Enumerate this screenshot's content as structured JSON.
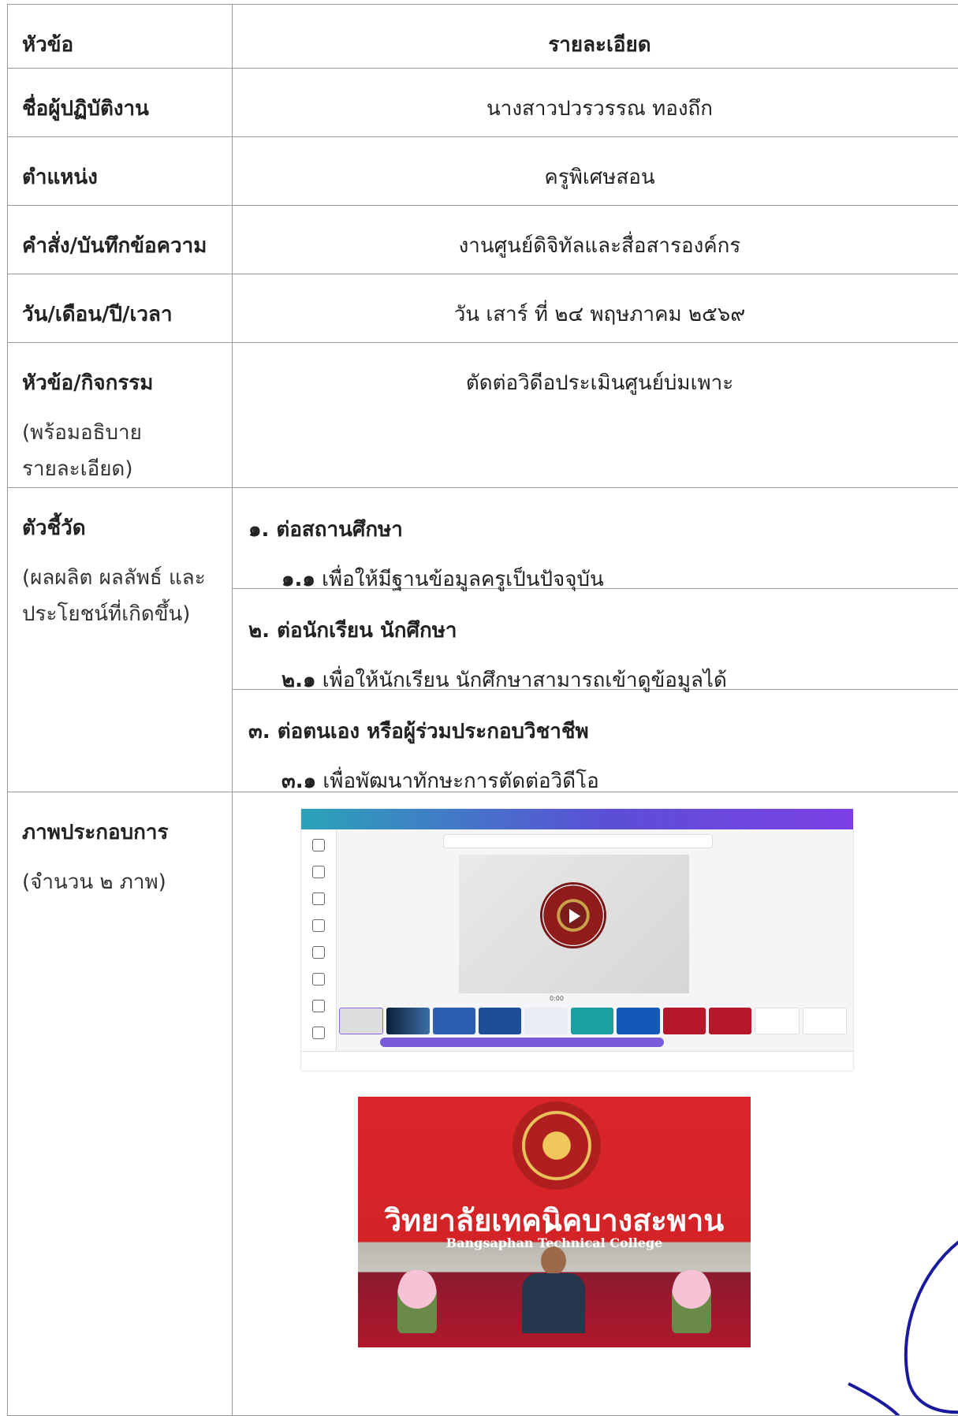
{
  "header": {
    "topic_label": "หัวข้อ",
    "detail_label": "รายละเอียด"
  },
  "rows": {
    "name": {
      "label": "ชื่อผู้ปฏิบัติงาน",
      "value": "นางสาวปวรวรรณ ทองถึก"
    },
    "position": {
      "label": "ตำแหน่ง",
      "value": "ครูพิเศษสอน"
    },
    "order": {
      "label": "คำสั่ง/บันทึกข้อความ",
      "value": "งานศูนย์ดิจิทัลและสื่อสารองค์กร"
    },
    "date": {
      "label": "วัน/เดือน/ปี/เวลา",
      "value": "วัน เสาร์ ที่ ๒๔ พฤษภาคม ๒๕๖๙"
    },
    "activity": {
      "label": "หัวข้อ/กิจกรรม",
      "sub1": "(พร้อมอธิบาย",
      "sub2": "รายละเอียด)",
      "value": "ตัดต่อวิดีอประเมินศูนย์บ่มเพาะ"
    }
  },
  "indicators": {
    "label": "ตัวชี้วัด",
    "sub1": "(ผลผลิต ผลลัพธ์ และ",
    "sub2": "ประโยชน์ที่เกิดขึ้น)",
    "items": [
      {
        "title": "๑. ต่อสถานศึกษา",
        "num": "๑.๑",
        "text": " เพื่อให้มีฐานข้อมูลครูเป็นปัจจุบัน"
      },
      {
        "title": "๒. ต่อนักเรียน นักศึกษา",
        "num": "๒.๑",
        "text": " เพื่อให้นักเรียน นักศึกษาสามารถเข้าดูข้อมูลได้"
      },
      {
        "title": "๓. ต่อตนเอง หรือผู้ร่วมประกอบวิชาชีพ",
        "num": "๓.๑",
        "text": " เพื่อพัฒนาทักษะการตัดต่อวิดีโอ"
      }
    ]
  },
  "photos": {
    "label": "ภาพประกอบการ",
    "sub": "(จำนวน ๒ ภาพ)",
    "editor_time": "0:00",
    "college_th": "วิทยาลัยเทคนิคบางสะพาน",
    "college_en": "Bangsaphan Technical College"
  }
}
